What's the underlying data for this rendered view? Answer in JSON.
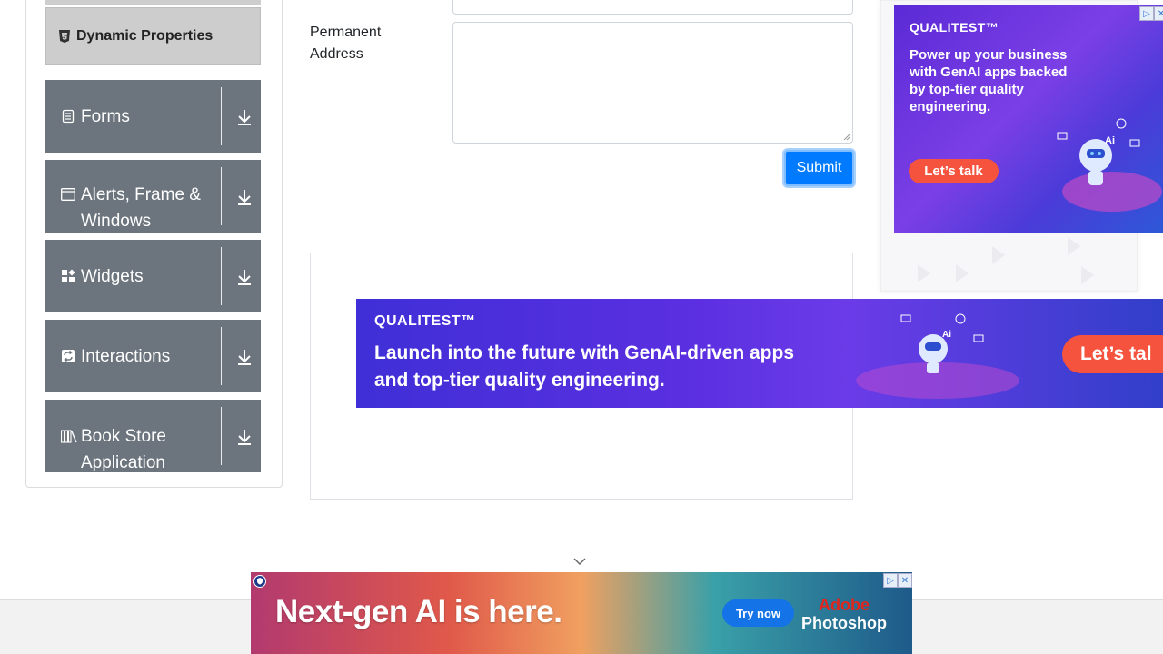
{
  "sidebar": {
    "active_item": "Dynamic Properties",
    "groups": [
      {
        "label": "Forms",
        "icon": "document-icon"
      },
      {
        "label": "Alerts, Frame & Windows",
        "icon": "window-icon"
      },
      {
        "label": "Widgets",
        "icon": "widgets-icon"
      },
      {
        "label": "Interactions",
        "icon": "interactions-icon"
      },
      {
        "label": "Book Store Application",
        "icon": "books-icon"
      }
    ]
  },
  "form": {
    "permanent_address_label": "Permanent Address",
    "submit_label": "Submit"
  },
  "ads": {
    "right": {
      "brand": "QUALITEST™",
      "text": "Power up your business with GenAI apps backed by top-tier quality engineering.",
      "cta": "Let’s talk"
    },
    "wide": {
      "brand": "QUALITEST™",
      "text": "Launch into the future with GenAI-driven apps and top-tier quality engineering.",
      "cta": "Let’s tal"
    },
    "bottom": {
      "text": "Next-gen AI is here.",
      "cta": "Try now",
      "logo_line1": "Adobe",
      "logo_line2": "Photoshop"
    }
  },
  "colors": {
    "group_bg": "#6c757d",
    "active_bg": "#cdcdcd",
    "submit_bg": "#007bff",
    "ad_cta": "#f5533d"
  }
}
